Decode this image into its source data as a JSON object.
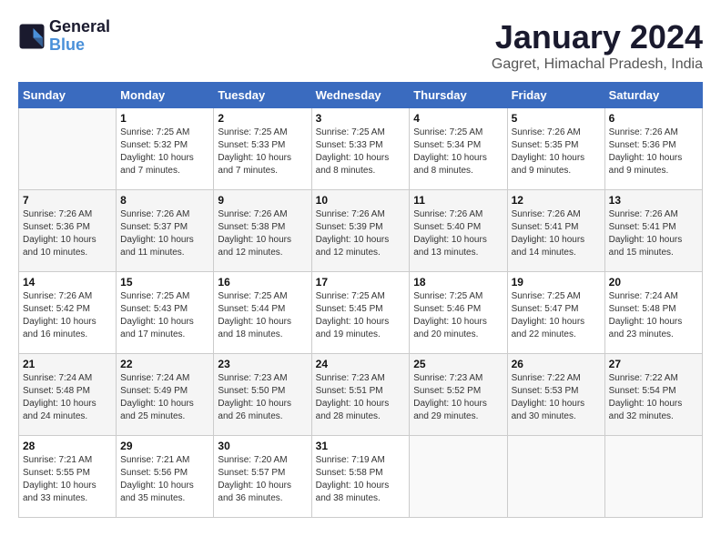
{
  "header": {
    "logo_line1": "General",
    "logo_line2": "Blue",
    "month": "January 2024",
    "location": "Gagret, Himachal Pradesh, India"
  },
  "weekdays": [
    "Sunday",
    "Monday",
    "Tuesday",
    "Wednesday",
    "Thursday",
    "Friday",
    "Saturday"
  ],
  "weeks": [
    [
      {
        "day": null
      },
      {
        "day": "1",
        "sunrise": "7:25 AM",
        "sunset": "5:32 PM",
        "daylight": "10 hours and 7 minutes."
      },
      {
        "day": "2",
        "sunrise": "7:25 AM",
        "sunset": "5:33 PM",
        "daylight": "10 hours and 7 minutes."
      },
      {
        "day": "3",
        "sunrise": "7:25 AM",
        "sunset": "5:33 PM",
        "daylight": "10 hours and 8 minutes."
      },
      {
        "day": "4",
        "sunrise": "7:25 AM",
        "sunset": "5:34 PM",
        "daylight": "10 hours and 8 minutes."
      },
      {
        "day": "5",
        "sunrise": "7:26 AM",
        "sunset": "5:35 PM",
        "daylight": "10 hours and 9 minutes."
      },
      {
        "day": "6",
        "sunrise": "7:26 AM",
        "sunset": "5:36 PM",
        "daylight": "10 hours and 9 minutes."
      }
    ],
    [
      {
        "day": "7",
        "sunrise": "7:26 AM",
        "sunset": "5:36 PM",
        "daylight": "10 hours and 10 minutes."
      },
      {
        "day": "8",
        "sunrise": "7:26 AM",
        "sunset": "5:37 PM",
        "daylight": "10 hours and 11 minutes."
      },
      {
        "day": "9",
        "sunrise": "7:26 AM",
        "sunset": "5:38 PM",
        "daylight": "10 hours and 12 minutes."
      },
      {
        "day": "10",
        "sunrise": "7:26 AM",
        "sunset": "5:39 PM",
        "daylight": "10 hours and 12 minutes."
      },
      {
        "day": "11",
        "sunrise": "7:26 AM",
        "sunset": "5:40 PM",
        "daylight": "10 hours and 13 minutes."
      },
      {
        "day": "12",
        "sunrise": "7:26 AM",
        "sunset": "5:41 PM",
        "daylight": "10 hours and 14 minutes."
      },
      {
        "day": "13",
        "sunrise": "7:26 AM",
        "sunset": "5:41 PM",
        "daylight": "10 hours and 15 minutes."
      }
    ],
    [
      {
        "day": "14",
        "sunrise": "7:26 AM",
        "sunset": "5:42 PM",
        "daylight": "10 hours and 16 minutes."
      },
      {
        "day": "15",
        "sunrise": "7:25 AM",
        "sunset": "5:43 PM",
        "daylight": "10 hours and 17 minutes."
      },
      {
        "day": "16",
        "sunrise": "7:25 AM",
        "sunset": "5:44 PM",
        "daylight": "10 hours and 18 minutes."
      },
      {
        "day": "17",
        "sunrise": "7:25 AM",
        "sunset": "5:45 PM",
        "daylight": "10 hours and 19 minutes."
      },
      {
        "day": "18",
        "sunrise": "7:25 AM",
        "sunset": "5:46 PM",
        "daylight": "10 hours and 20 minutes."
      },
      {
        "day": "19",
        "sunrise": "7:25 AM",
        "sunset": "5:47 PM",
        "daylight": "10 hours and 22 minutes."
      },
      {
        "day": "20",
        "sunrise": "7:24 AM",
        "sunset": "5:48 PM",
        "daylight": "10 hours and 23 minutes."
      }
    ],
    [
      {
        "day": "21",
        "sunrise": "7:24 AM",
        "sunset": "5:48 PM",
        "daylight": "10 hours and 24 minutes."
      },
      {
        "day": "22",
        "sunrise": "7:24 AM",
        "sunset": "5:49 PM",
        "daylight": "10 hours and 25 minutes."
      },
      {
        "day": "23",
        "sunrise": "7:23 AM",
        "sunset": "5:50 PM",
        "daylight": "10 hours and 26 minutes."
      },
      {
        "day": "24",
        "sunrise": "7:23 AM",
        "sunset": "5:51 PM",
        "daylight": "10 hours and 28 minutes."
      },
      {
        "day": "25",
        "sunrise": "7:23 AM",
        "sunset": "5:52 PM",
        "daylight": "10 hours and 29 minutes."
      },
      {
        "day": "26",
        "sunrise": "7:22 AM",
        "sunset": "5:53 PM",
        "daylight": "10 hours and 30 minutes."
      },
      {
        "day": "27",
        "sunrise": "7:22 AM",
        "sunset": "5:54 PM",
        "daylight": "10 hours and 32 minutes."
      }
    ],
    [
      {
        "day": "28",
        "sunrise": "7:21 AM",
        "sunset": "5:55 PM",
        "daylight": "10 hours and 33 minutes."
      },
      {
        "day": "29",
        "sunrise": "7:21 AM",
        "sunset": "5:56 PM",
        "daylight": "10 hours and 35 minutes."
      },
      {
        "day": "30",
        "sunrise": "7:20 AM",
        "sunset": "5:57 PM",
        "daylight": "10 hours and 36 minutes."
      },
      {
        "day": "31",
        "sunrise": "7:19 AM",
        "sunset": "5:58 PM",
        "daylight": "10 hours and 38 minutes."
      },
      {
        "day": null
      },
      {
        "day": null
      },
      {
        "day": null
      }
    ]
  ]
}
